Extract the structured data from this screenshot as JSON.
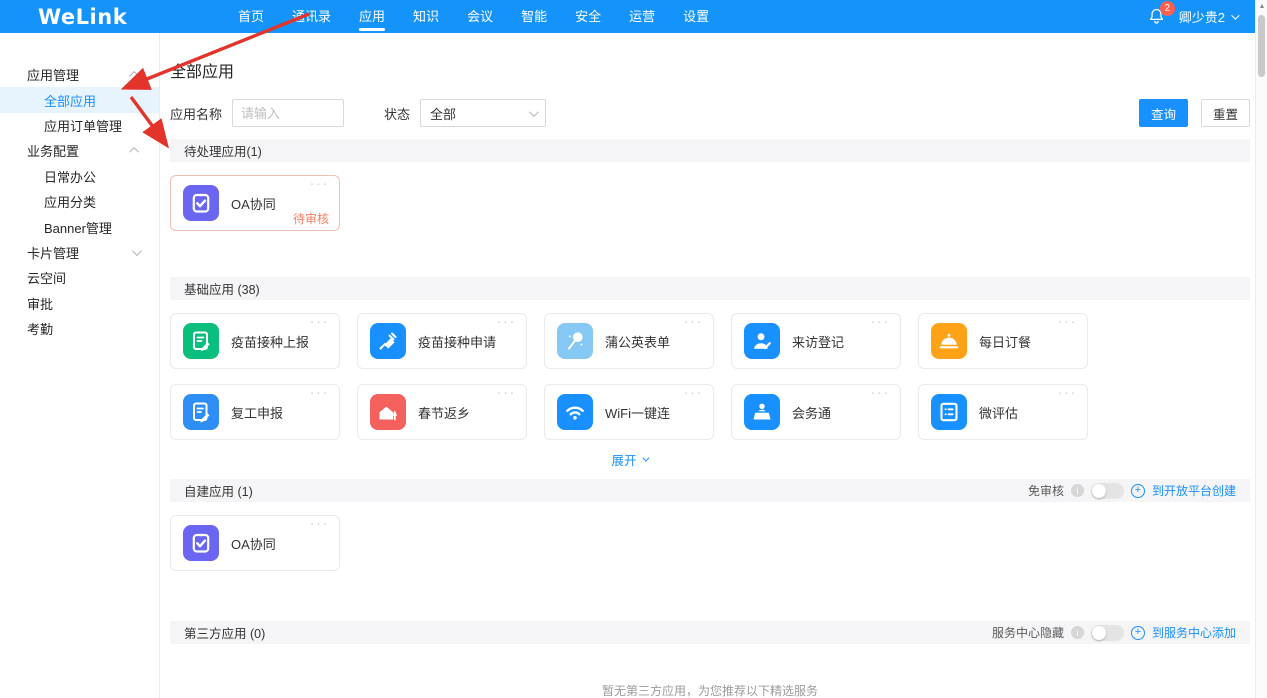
{
  "topbar": {
    "logo": "WeLink",
    "nav": [
      {
        "label": "首页"
      },
      {
        "label": "通讯录"
      },
      {
        "label": "应用",
        "active": true
      },
      {
        "label": "知识"
      },
      {
        "label": "会议"
      },
      {
        "label": "智能"
      },
      {
        "label": "安全"
      },
      {
        "label": "运营"
      },
      {
        "label": "设置"
      }
    ],
    "notification_count": "2",
    "user_name": "卿少贵2"
  },
  "sidebar": {
    "items": [
      {
        "label": "应用管理",
        "type": "group",
        "chevron": "up"
      },
      {
        "label": "全部应用",
        "type": "child",
        "selected": true
      },
      {
        "label": "应用订单管理",
        "type": "child"
      },
      {
        "label": "业务配置",
        "type": "group",
        "chevron": "up"
      },
      {
        "label": "日常办公",
        "type": "child"
      },
      {
        "label": "应用分类",
        "type": "child"
      },
      {
        "label": "Banner管理",
        "type": "child"
      },
      {
        "label": "卡片管理",
        "type": "group",
        "chevron": "down"
      },
      {
        "label": "云空间",
        "type": "group"
      },
      {
        "label": "审批",
        "type": "group"
      },
      {
        "label": "考勤",
        "type": "group"
      }
    ]
  },
  "main": {
    "title": "全部应用",
    "filters": {
      "name_label": "应用名称",
      "name_placeholder": "请输入",
      "status_label": "状态",
      "status_value": "全部",
      "search_button": "查询",
      "reset_button": "重置"
    },
    "sections": {
      "pending": {
        "title": "待处理应用(1)",
        "apps": [
          {
            "name": "OA协同",
            "icon": "clipboard-check-icon",
            "color": "#6b66f2",
            "status": "待审核",
            "border": "#f3beb6"
          }
        ]
      },
      "basic": {
        "title": "基础应用 (38)",
        "expand_label": "展开",
        "apps": [
          {
            "name": "疫苗接种上报",
            "icon": "vaccine-report-icon",
            "color": "#0abf7d"
          },
          {
            "name": "疫苗接种申请",
            "icon": "syringe-icon",
            "color": "#1890ff"
          },
          {
            "name": "蒲公英表单",
            "icon": "dandelion-icon",
            "color": "#85c8f4"
          },
          {
            "name": "来访登记",
            "icon": "visitor-icon",
            "color": "#1890ff"
          },
          {
            "name": "每日订餐",
            "icon": "meal-icon",
            "color": "#ffa216"
          },
          {
            "name": "复工申报",
            "icon": "work-resume-icon",
            "color": "#2f8ef5"
          },
          {
            "name": "春节返乡",
            "icon": "home-return-icon",
            "color": "#f4605c"
          },
          {
            "name": "WiFi一键连",
            "icon": "wifi-icon",
            "color": "#1890ff"
          },
          {
            "name": "会务通",
            "icon": "conference-icon",
            "color": "#1890ff"
          },
          {
            "name": "微评估",
            "icon": "evaluation-icon",
            "color": "#1890ff"
          }
        ]
      },
      "selfbuilt": {
        "title": "自建应用 (1)",
        "toggle_label": "免审核",
        "link_label": "到开放平台创建",
        "apps": [
          {
            "name": "OA协同",
            "icon": "clipboard-check-icon",
            "color": "#6b66f2"
          }
        ]
      },
      "third": {
        "title": "第三方应用 (0)",
        "toggle_label": "服务中心隐藏",
        "link_label": "到服务中心添加",
        "empty_text": "暂无第三方应用，为您推荐以下精选服务"
      }
    }
  },
  "colors": {
    "topbar_blue": "#1493fb",
    "accent_blue": "#1890ff",
    "pending_status": "#f57f66",
    "annotation_red": "#e3342b"
  }
}
